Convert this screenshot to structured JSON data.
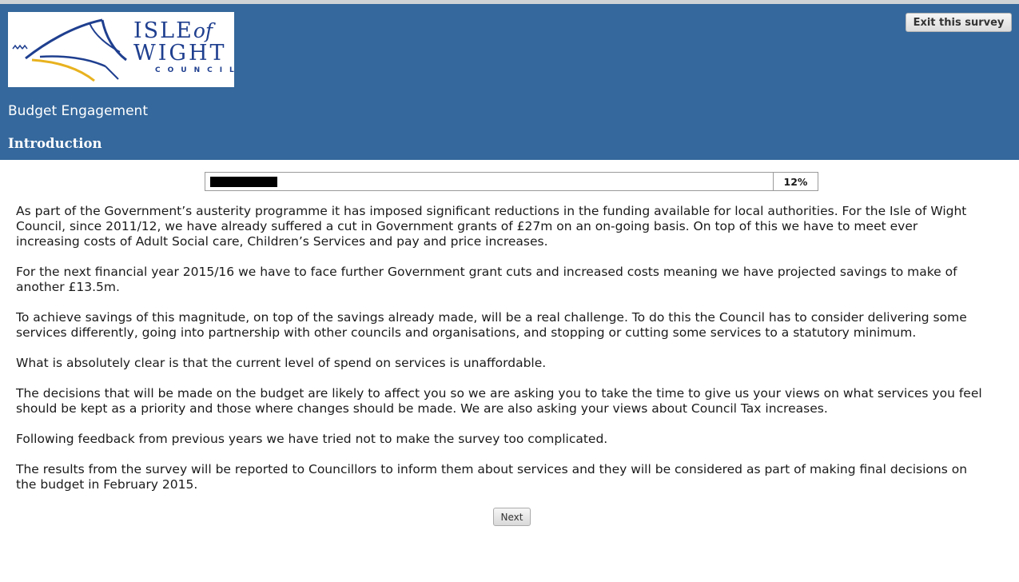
{
  "header": {
    "logo": {
      "line1": "ISLE",
      "line1_of": "of",
      "line2": "WIGHT",
      "line3": "COUNCIL"
    },
    "exit_label": "Exit this survey",
    "survey_title": "Budget Engagement",
    "section_title": "Introduction"
  },
  "progress": {
    "fraction": 0.12,
    "label": "12%"
  },
  "paragraphs": [
    [
      "As part of the Government’s austerity programme it has imposed significant reductions in the funding available for local authorities. For the Isle of Wight",
      "Council, since 2011/12, we have already suffered a cut in Government grants of £27m on an on-going basis. On top of this we have to meet ever",
      "increasing costs of Adult Social care, Children’s Services and pay and price increases."
    ],
    [
      "For the next financial year 2015/16 we have to face further Government grant cuts and increased costs meaning we have projected savings to make of",
      "another £13.5m."
    ],
    [
      "To achieve savings of this magnitude, on top of the savings already made, will be a real challenge. To do this the Council has to consider delivering some",
      "services differently, going into partnership with other councils and organisations, and stopping or cutting some services to a statutory minimum."
    ],
    [
      "What is absolutely clear is that the current level of spend on services is unaffordable."
    ],
    [
      "The decisions that will be made on the budget are likely to affect you so we are asking you to take the time to give us your views on what services you feel",
      "should be kept as a priority and those where changes should be made. We are also asking your views about Council Tax increases."
    ],
    [
      "Following feedback from previous years we have tried not to make the survey too complicated."
    ],
    [
      "The results from the survey will be reported to Councillors to inform them about services and they will be considered as part of making final decisions on",
      "the budget in February 2015."
    ]
  ],
  "footer": {
    "next_label": "Next"
  },
  "colors": {
    "header_bg": "#35689c",
    "logo_blue": "#1f3f8f",
    "logo_gold": "#e8b21f"
  }
}
